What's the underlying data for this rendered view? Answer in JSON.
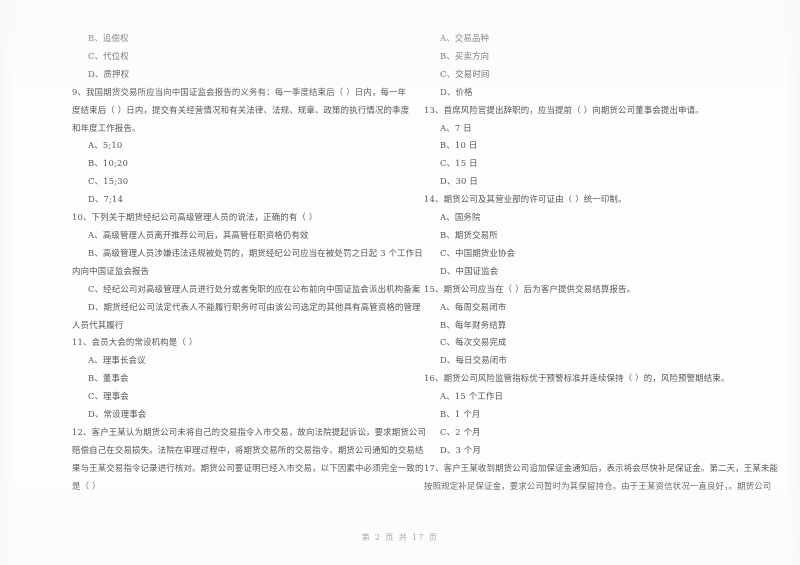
{
  "document": {
    "type": "scanned-exam-paper",
    "language": "zh-CN",
    "footer": "第 2 页 共 17 页"
  },
  "left_column": {
    "lines": [
      {
        "kind": "option",
        "text": "B、追偿权"
      },
      {
        "kind": "option",
        "text": "C、代位权"
      },
      {
        "kind": "option",
        "text": "D、质押权"
      },
      {
        "kind": "question",
        "text": "9、我国期货交易所应当向中国证监会报告的义务有：每一季度结束后（        ）日内，每一年"
      },
      {
        "kind": "continuation",
        "text": "度结束后（        ）日内，提交有关经营情况和有关法律、法规、规章、政策的执行情况的季度"
      },
      {
        "kind": "continuation",
        "text": "和年度工作报告。"
      },
      {
        "kind": "option",
        "text": "A、5;10"
      },
      {
        "kind": "option",
        "text": "B、10;20"
      },
      {
        "kind": "option",
        "text": "C、15;30"
      },
      {
        "kind": "option",
        "text": "D、7;14"
      },
      {
        "kind": "question",
        "text": "10、下列关于期货经纪公司高级管理人员的说法，正确的有（        ）"
      },
      {
        "kind": "option",
        "text": "A、高级管理人员离开推荐公司后，其高管任职资格仍有效"
      },
      {
        "kind": "option",
        "text": "B、高级管理人员涉嫌违法违规被处罚的，期货经纪公司应当在被处罚之日起 3 个工作日"
      },
      {
        "kind": "continuation",
        "text": "内向中国证监会报告"
      },
      {
        "kind": "option",
        "text": "C、经纪公司对高级管理人员进行处分或者免职的应在公布前向中国证监会派出机构备案"
      },
      {
        "kind": "option",
        "text": "D、期货经纪公司法定代表人不能履行职务时可由该公司选定的其他具有高管资格的管理"
      },
      {
        "kind": "continuation",
        "text": "人员代其履行"
      },
      {
        "kind": "question",
        "text": "11、会员大会的常设机构是（        ）"
      },
      {
        "kind": "option",
        "text": "A、理事长会议"
      },
      {
        "kind": "option",
        "text": "B、董事会"
      },
      {
        "kind": "option",
        "text": "C、理事会"
      },
      {
        "kind": "option",
        "text": "D、常设理事会"
      },
      {
        "kind": "question",
        "text": "12、客户王某认为期货公司未将自己的交易指令入市交易，故向法院提起诉讼，要求期货公司"
      },
      {
        "kind": "continuation",
        "text": "赔偿自己在交易损失。法院在审理过程中，将期货交易所的交易指令、期货公司通知的交易结"
      },
      {
        "kind": "continuation",
        "text": "果与王某交易指令记录进行核对。期货公司要证明已经入市交易，以下因素中必须完全一致的"
      },
      {
        "kind": "continuation",
        "text": "是（        ）"
      }
    ]
  },
  "right_column": {
    "lines": [
      {
        "kind": "option",
        "text": "A、交易品种"
      },
      {
        "kind": "option",
        "text": "B、买卖方向"
      },
      {
        "kind": "option",
        "text": "C、交易时间"
      },
      {
        "kind": "option",
        "text": "D、价格"
      },
      {
        "kind": "question",
        "text": "13、首席风险官提出辞职的，应当提前（        ）向期货公司董事会提出申请。"
      },
      {
        "kind": "option",
        "text": "A、7 日"
      },
      {
        "kind": "option",
        "text": "B、10 日"
      },
      {
        "kind": "option",
        "text": "C、15 日"
      },
      {
        "kind": "option",
        "text": "D、30 日"
      },
      {
        "kind": "question",
        "text": "14、期货公司及其营业部的许可证由（        ）统一印制。"
      },
      {
        "kind": "option",
        "text": "A、国务院"
      },
      {
        "kind": "option",
        "text": "B、期货交易所"
      },
      {
        "kind": "option",
        "text": "C、中国期货业协会"
      },
      {
        "kind": "option",
        "text": "D、中国证监会"
      },
      {
        "kind": "question",
        "text": "15、期货公司应当在（        ）后为客户提供交易结算报告。"
      },
      {
        "kind": "option",
        "text": "A、每周交易闭市"
      },
      {
        "kind": "option",
        "text": "B、每年财务结算"
      },
      {
        "kind": "option",
        "text": "C、每次交易完成"
      },
      {
        "kind": "option",
        "text": "D、每日交易闭市"
      },
      {
        "kind": "question",
        "text": "16、期货公司风险监管指标优于预警标准并连续保持（        ）的，风险预警期结束。"
      },
      {
        "kind": "option",
        "text": "A、15 个工作日"
      },
      {
        "kind": "option",
        "text": "B、1 个月"
      },
      {
        "kind": "option",
        "text": "C、2 个月"
      },
      {
        "kind": "option",
        "text": "D、3 个月"
      },
      {
        "kind": "question",
        "text": "17、客户王某收到期货公司追加保证金通知后，表示将会尽快补足保证金。第二天，王某未能"
      },
      {
        "kind": "continuation",
        "text": "按照规定补足保证金，要求公司暂时为其保留持仓。由于王某资信状况一直良好，。期货公司"
      }
    ]
  }
}
